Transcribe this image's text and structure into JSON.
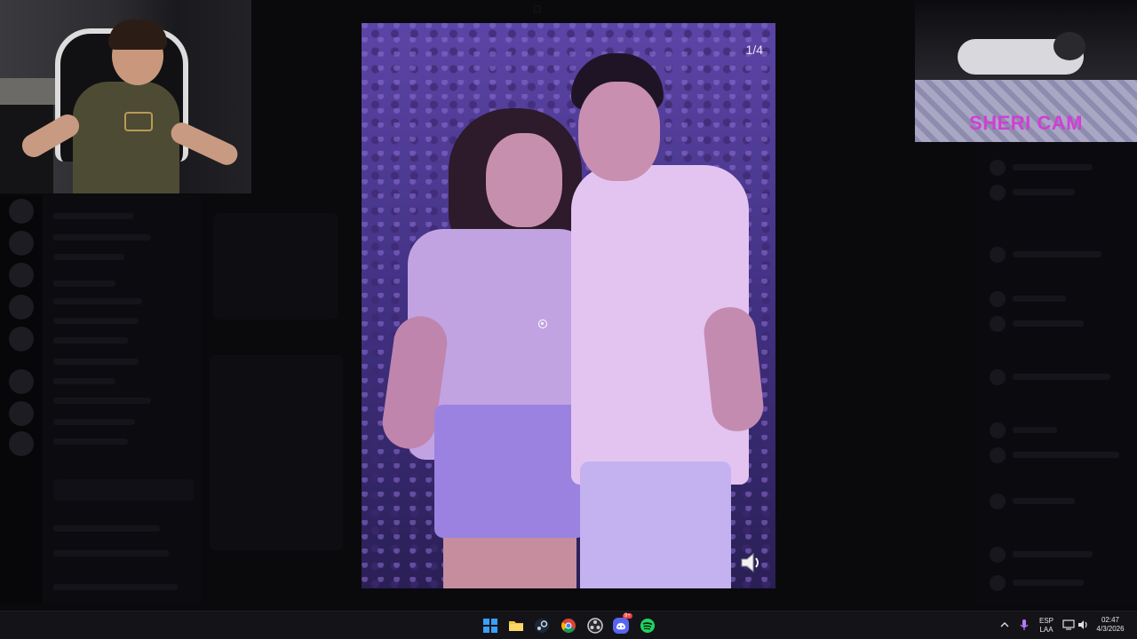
{
  "viewer": {
    "counter": "1/4"
  },
  "overlay": {
    "sheri_cam_label": "SHERI CAM"
  },
  "taskbar": {
    "apps": [
      {
        "name": "windows-start"
      },
      {
        "name": "file-explorer"
      },
      {
        "name": "steam"
      },
      {
        "name": "chrome"
      },
      {
        "name": "obs"
      },
      {
        "name": "discord",
        "badge": "9+"
      },
      {
        "name": "spotify"
      }
    ],
    "tray": {
      "language_top": "ESP",
      "language_bottom": "LAA",
      "time": "02:47",
      "date": "4/3/2026"
    }
  },
  "colors": {
    "sheri_label": "#d03fd4",
    "windows_accent": "#3aa0ff",
    "spotify": "#1ed760"
  }
}
